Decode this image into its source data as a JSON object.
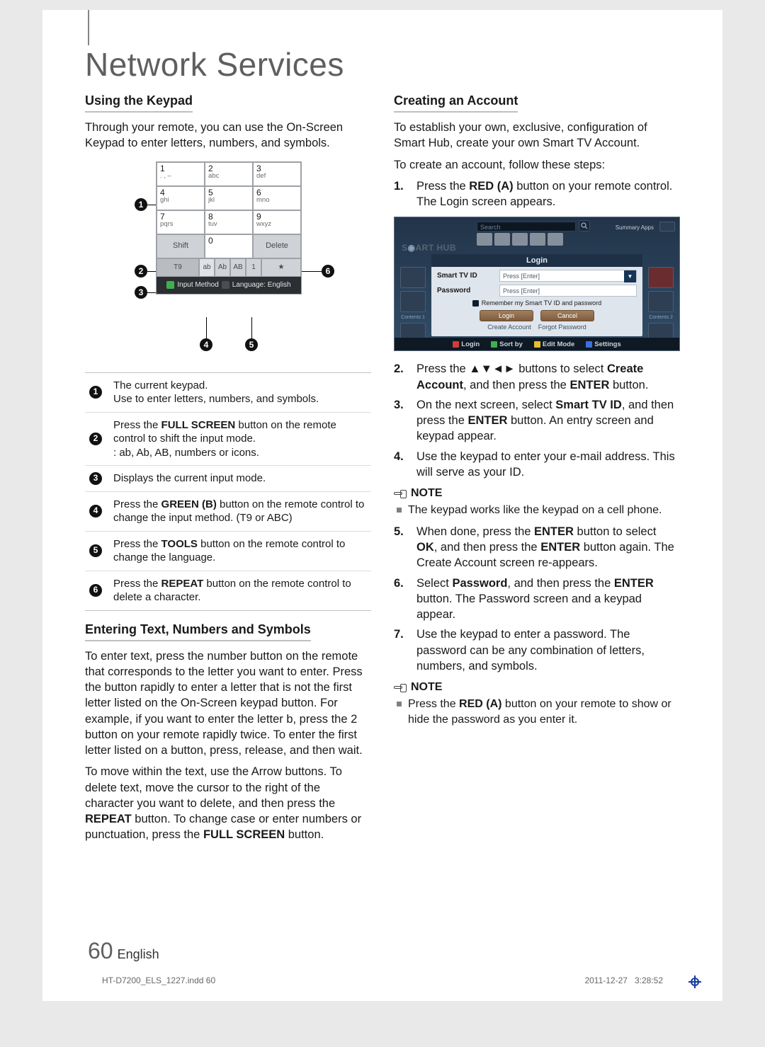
{
  "page": {
    "number": "60",
    "language": "English"
  },
  "header": {
    "title": "Network Services"
  },
  "footer": {
    "indd": "HT-D7200_ELS_1227.indd   60",
    "date": "2011-12-27",
    "time": "3:28:52"
  },
  "left": {
    "h2a": "Using the Keypad",
    "intro": "Through your remote, you can use the On-Screen Keypad to enter letters, numbers, and symbols.",
    "keypad": {
      "rows": [
        [
          {
            "d": "1",
            "l": ". , –"
          },
          {
            "d": "2",
            "l": "abc"
          },
          {
            "d": "3",
            "l": "def"
          }
        ],
        [
          {
            "d": "4",
            "l": "ghi"
          },
          {
            "d": "5",
            "l": "jkl"
          },
          {
            "d": "6",
            "l": "mno"
          }
        ],
        [
          {
            "d": "7",
            "l": "pqrs"
          },
          {
            "d": "8",
            "l": "tuv"
          },
          {
            "d": "9",
            "l": "wxyz"
          }
        ]
      ],
      "row4": {
        "shift": "Shift",
        "zero": "0",
        "delete": "Delete"
      },
      "row5": {
        "t9": "T9",
        "m1": "ab",
        "m2": "Ab",
        "m3": "AB",
        "m4": "1",
        "m5": "★"
      },
      "footer": {
        "b_label": "Input Method",
        "t_label": "Language: English"
      }
    },
    "table": [
      {
        "n": "1",
        "text_a": "The current keypad.",
        "text_b": "Use to enter letters, numbers, and symbols."
      },
      {
        "n": "2",
        "pre": "Press the ",
        "bold": "FULL SCREEN",
        "post": " button on the remote control to shift the input mode.",
        "line2": ": ab, Ab, AB, numbers or icons."
      },
      {
        "n": "3",
        "text": "Displays the current input mode."
      },
      {
        "n": "4",
        "pre": "Press the ",
        "bold": "GREEN (B)",
        "post": " button on the remote control to change the input method. (T9 or ABC)"
      },
      {
        "n": "5",
        "pre": "Press the ",
        "bold": "TOOLS",
        "post": " button on the remote control to change the language."
      },
      {
        "n": "6",
        "pre": "Press the ",
        "bold": "REPEAT",
        "post": " button on the remote control to delete a character."
      }
    ],
    "h2b": "Entering Text, Numbers and Symbols",
    "para2": "To enter text, press the number button on the remote that corresponds to the letter you want to enter. Press the button rapidly to enter a letter that is not the first letter listed on the On-Screen keypad button. For example, if you want to enter the letter b, press the 2 button on your remote rapidly twice. To enter the first letter listed on a button, press, release, and then wait.",
    "para3_a": "To move within the text, use the Arrow buttons. To delete text, move the cursor to the right of the character you want to delete, and then press the ",
    "para3_b": "REPEAT",
    "para3_c": " button. To change case or enter numbers or punctuation, press the ",
    "para3_d": "FULL SCREEN",
    "para3_e": " button."
  },
  "right": {
    "h2": "Creating an Account",
    "intro": "To establish your own, exclusive, configuration of Smart Hub, create your own Smart TV Account.",
    "intro2": "To create an account, follow these steps:",
    "step1_pre": "Press the ",
    "step1_b": "RED (A)",
    "step1_post": " button on your remote control. The Login screen appears.",
    "login": {
      "search": "Search",
      "summary": "Summary Apps",
      "brand_a": "S",
      "brand_b": "ART HUB",
      "title": "Login",
      "id_label": "Smart TV ID",
      "id_ph": "Press [Enter]",
      "pw_label": "Password",
      "pw_ph": "Press [Enter]",
      "remember": "Remember my Smart TV ID and password",
      "btn_login": "Login",
      "btn_cancel": "Cancel",
      "link_create": "Create Account",
      "link_forgot": "Forgot Password",
      "left_caps": [
        "",
        "Contents 1",
        ""
      ],
      "right_caps": [
        "",
        "Contents 2",
        ""
      ],
      "foot": {
        "a": "Login",
        "b": "Sort by",
        "c": "Edit Mode",
        "d": "Settings"
      }
    },
    "step2_pre": "Press the ",
    "step2_arrows": "▲▼◄►",
    "step2_mid": " buttons to select ",
    "step2_b1": "Create Account",
    "step2_mid2": ", and then press the ",
    "step2_b2": "ENTER",
    "step2_post": " button.",
    "step3_pre": "On the next screen, select ",
    "step3_b1": "Smart TV ID",
    "step3_mid": ", and then press the ",
    "step3_b2": "ENTER",
    "step3_post": " button. An entry screen and keypad appear.",
    "step4": "Use the keypad to enter your e-mail address. This will serve as your ID.",
    "note_label": "NOTE",
    "note1": "The keypad works like the keypad on a cell phone.",
    "step5_pre": "When done, press the ",
    "step5_b1": "ENTER",
    "step5_mid": " button to select ",
    "step5_b2": "OK",
    "step5_mid2": ", and then press the ",
    "step5_b3": "ENTER",
    "step5_post": " button again. The Create Account screen re-appears.",
    "step6_pre": "Select ",
    "step6_b1": "Password",
    "step6_mid": ", and then press the ",
    "step6_b2": "ENTER",
    "step6_post": " button. The Password screen and a keypad appear.",
    "step7": "Use the keypad to enter a password. The password can be any combination of letters, numbers, and symbols.",
    "note2_pre": "Press the ",
    "note2_b": "RED (A)",
    "note2_post": " button on your remote to show or hide the password as you enter it."
  }
}
